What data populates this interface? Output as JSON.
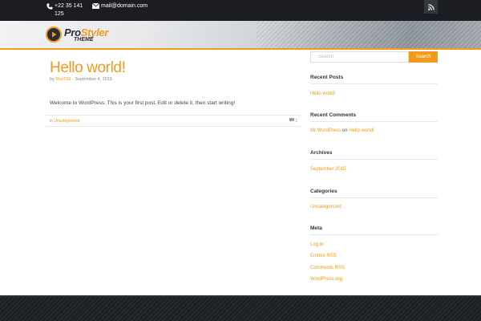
{
  "topbar": {
    "phone": "+22 35 141",
    "phone_cont": "125",
    "email": "mail@domain.com"
  },
  "header": {
    "logo_pro": "Pro",
    "logo_styler": "Styler",
    "logo_theme": "THEME"
  },
  "post": {
    "title": "Hello world!",
    "meta_by": "by",
    "author": "Roy739",
    "date": " - September 4, 2015",
    "body": "Welcome to WordPress. This is your first post. Edit or delete it, then start writing!",
    "cat_prefix": "in ",
    "category": "Uncategorized",
    "comment_count": "1"
  },
  "sidebar": {
    "search_placeholder": "Search",
    "search_button": "Search",
    "recent_posts_title": "Recent Posts",
    "recent_post": "Hello world!",
    "recent_comments_title": "Recent Comments",
    "comment_author": "Mr WordPress",
    "comment_on": " on ",
    "comment_post": "Hello world!",
    "archives_title": "Archives",
    "archive_item": "September 2015",
    "categories_title": "Categories",
    "category_item": "Uncategorized",
    "meta_title": "Meta",
    "meta_items": [
      "Log in",
      "Entries RSS",
      "Comments RSS",
      "WordPress.org"
    ]
  },
  "colors": {
    "accent": "#f39a1d",
    "topbar_bg": "#1b1d22",
    "footer_bg": "#1e2126"
  },
  "icons": [
    "phone-icon",
    "mail-icon",
    "rss-icon",
    "play-icon",
    "comment-icon"
  ]
}
